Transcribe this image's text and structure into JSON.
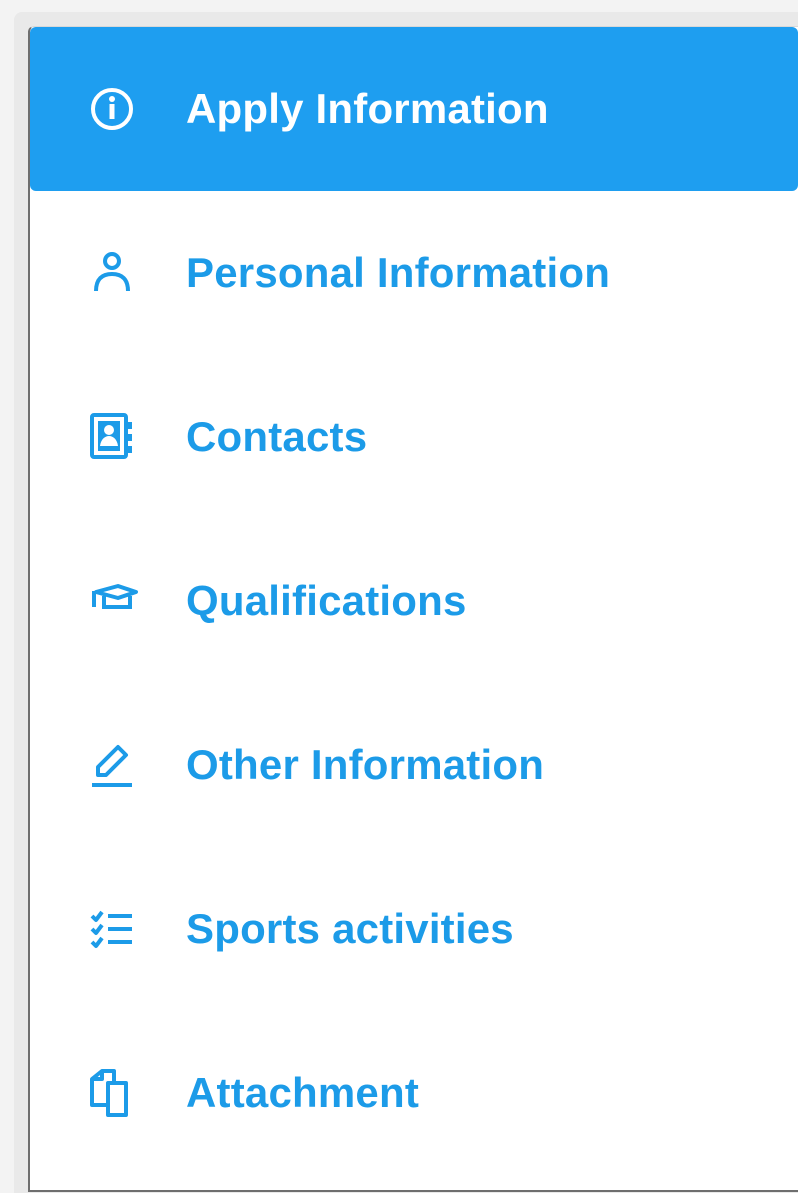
{
  "menu": {
    "items": [
      {
        "id": "apply-information",
        "label": "Apply Information",
        "icon": "info-circle-icon",
        "active": true
      },
      {
        "id": "personal-information",
        "label": "Personal Information",
        "icon": "user-icon",
        "active": false
      },
      {
        "id": "contacts",
        "label": "Contacts",
        "icon": "contact-card-icon",
        "active": false
      },
      {
        "id": "qualifications",
        "label": "Qualifications",
        "icon": "graduation-cap-icon",
        "active": false
      },
      {
        "id": "other-information",
        "label": "Other Information",
        "icon": "pencil-icon",
        "active": false
      },
      {
        "id": "sports-activities",
        "label": "Sports activities",
        "icon": "checklist-icon",
        "active": false
      },
      {
        "id": "attachment",
        "label": "Attachment",
        "icon": "documents-icon",
        "active": false
      }
    ]
  },
  "colors": {
    "accent": "#1e9ef0",
    "active_text": "#ffffff",
    "inactive_text": "#1c9be8",
    "panel_background": "#ffffff"
  }
}
